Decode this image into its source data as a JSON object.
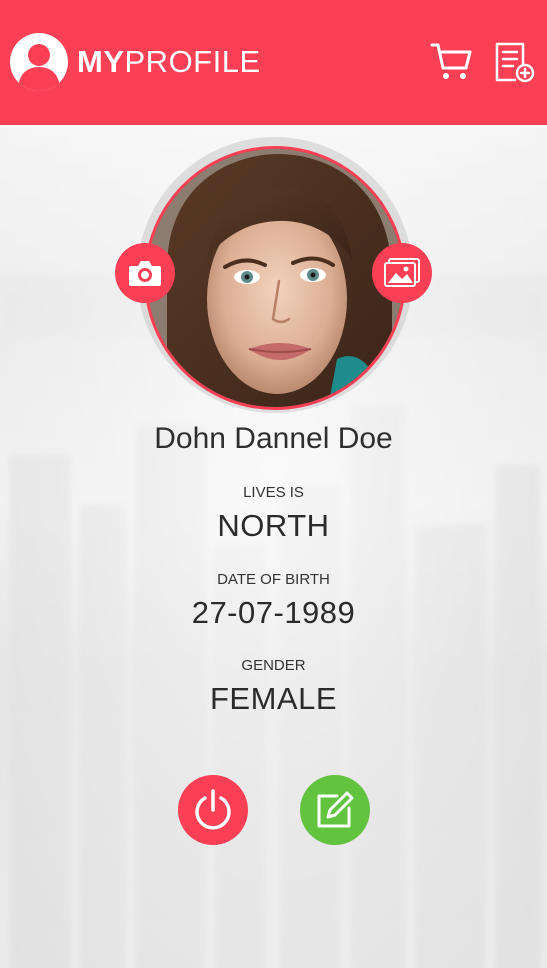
{
  "header": {
    "title_bold": "MY",
    "title_light": "PROFILE",
    "brand_icon": "user-avatar-icon",
    "actions": [
      {
        "name": "cart",
        "icon": "shopping-cart-icon"
      },
      {
        "name": "add-list",
        "icon": "list-add-icon"
      }
    ]
  },
  "profile": {
    "name": "Dohn Dannel Doe",
    "fields": [
      {
        "label": "LIVES IS",
        "value": "NORTH"
      },
      {
        "label": "DATE OF BIRTH",
        "value": "27-07-1989"
      },
      {
        "label": "GENDER",
        "value": "FEMALE"
      }
    ]
  },
  "photo_actions": {
    "camera_icon": "camera-icon",
    "gallery_icon": "image-gallery-icon"
  },
  "bottom_actions": {
    "power_icon": "power-icon",
    "edit_icon": "edit-icon"
  },
  "colors": {
    "accent": "#fb3f55",
    "edit_green": "#62c33f",
    "text": "#2b2b2b"
  }
}
